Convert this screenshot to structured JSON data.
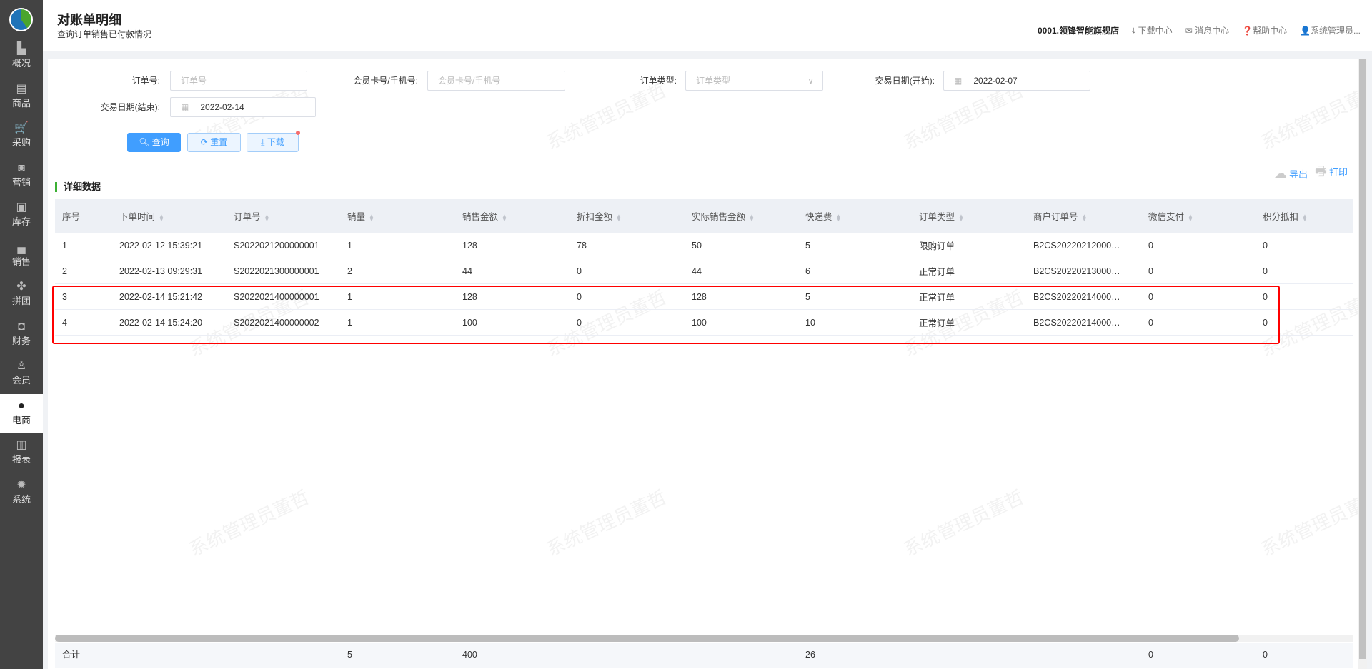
{
  "sidebar": {
    "items": [
      {
        "label": "概况",
        "icon": "building-icon",
        "glyph": "▙"
      },
      {
        "label": "商品",
        "icon": "document-icon",
        "glyph": "▤"
      },
      {
        "label": "采购",
        "icon": "cart-icon",
        "glyph": "🛒"
      },
      {
        "label": "营销",
        "icon": "badge-icon",
        "glyph": "◙"
      },
      {
        "label": "库存",
        "icon": "box-icon",
        "glyph": "▣"
      },
      {
        "label": "销售",
        "icon": "register-icon",
        "glyph": "▄"
      },
      {
        "label": "拼团",
        "icon": "clover-icon",
        "glyph": "✤"
      },
      {
        "label": "财务",
        "icon": "wallet-icon",
        "glyph": "◘"
      },
      {
        "label": "会员",
        "icon": "user-icon",
        "glyph": "♙"
      },
      {
        "label": "电商",
        "icon": "person-icon",
        "glyph": "●"
      },
      {
        "label": "报表",
        "icon": "presentation-icon",
        "glyph": "▥"
      },
      {
        "label": "系统",
        "icon": "gear-icon",
        "glyph": "✹"
      }
    ],
    "active": "电商"
  },
  "header": {
    "title": "对账单明细",
    "subtitle": "查询订单销售已付款情况",
    "store": "0001.领锋智能旗舰店",
    "download_center": "下载中心",
    "messages": "消息中心",
    "help": "帮助中心",
    "user": "系统管理员..."
  },
  "filters": {
    "order_no": {
      "label": "订单号:",
      "placeholder": "订单号"
    },
    "member": {
      "label": "会员卡号/手机号:",
      "placeholder": "会员卡号/手机号"
    },
    "order_type": {
      "label": "订单类型:",
      "placeholder": "订单类型"
    },
    "date_start": {
      "label": "交易日期(开始):",
      "value": "2022-02-07"
    },
    "date_end": {
      "label": "交易日期(结束):",
      "value": "2022-02-14"
    }
  },
  "buttons": {
    "query": "查询",
    "reset": "重置",
    "download": "下载",
    "export": "导出",
    "print": "打印"
  },
  "section_title": "详细数据",
  "table": {
    "columns": [
      "序号",
      "下单时间",
      "订单号",
      "销量",
      "销售金额",
      "折扣金额",
      "实际销售金额",
      "快递费",
      "订单类型",
      "商户订单号",
      "微信支付",
      "积分抵扣"
    ],
    "rows": [
      [
        "1",
        "2022-02-12 15:39:21",
        "S2022021200000001",
        "1",
        "128",
        "78",
        "50",
        "5",
        "限购订单",
        "B2CS20220212000000...",
        "0",
        "0"
      ],
      [
        "2",
        "2022-02-13 09:29:31",
        "S2022021300000001",
        "2",
        "44",
        "0",
        "44",
        "6",
        "正常订单",
        "B2CS20220213000000...",
        "0",
        "0"
      ],
      [
        "3",
        "2022-02-14 15:21:42",
        "S2022021400000001",
        "1",
        "128",
        "0",
        "128",
        "5",
        "正常订单",
        "B2CS20220214000000...",
        "0",
        "0"
      ],
      [
        "4",
        "2022-02-14 15:24:20",
        "S2022021400000002",
        "1",
        "100",
        "0",
        "100",
        "10",
        "正常订单",
        "B2CS20220214000000...",
        "0",
        "0"
      ]
    ],
    "footer": [
      "合计",
      "",
      "",
      "5",
      "400",
      "",
      "",
      "26",
      "",
      "",
      "0",
      "0"
    ]
  },
  "watermark": "系统管理员董哲",
  "colors": {
    "primary": "#409eff",
    "sidebar": "#434343",
    "highlight": "#ff0000",
    "section_accent": "#3cb034"
  }
}
